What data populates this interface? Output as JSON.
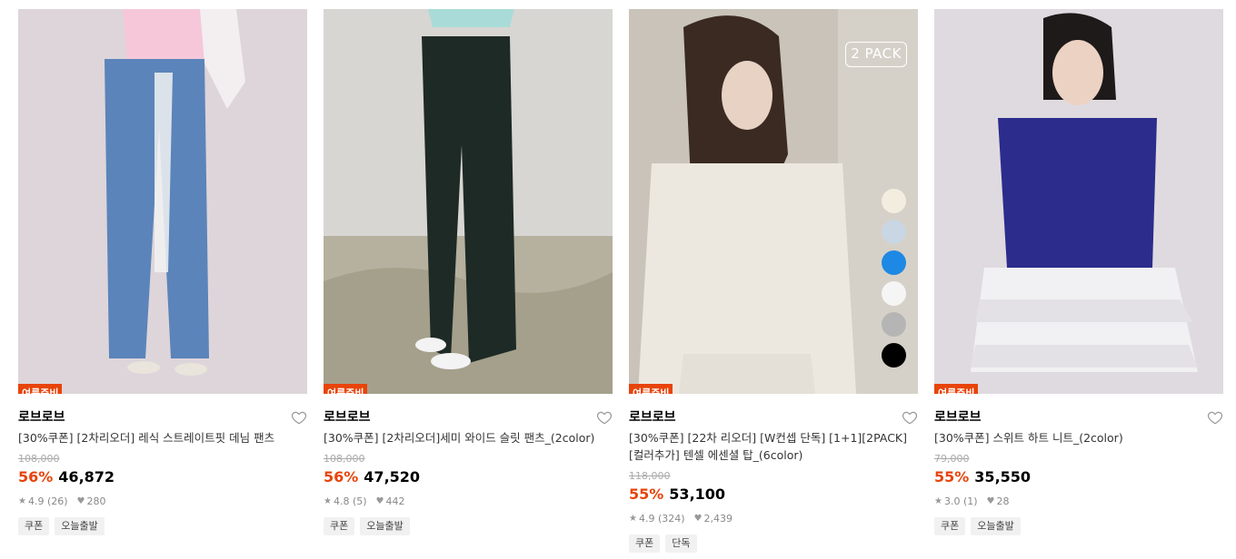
{
  "products": [
    {
      "promo": "여름준비",
      "brand": "로브로브",
      "title": "[30%쿠폰] [2차리오더] 레식 스트레이트핏 데님 팬츠",
      "original_price": "108,000",
      "discount": "56%",
      "price": "46,872",
      "rating": "4.9 (26)",
      "likes": "280",
      "tags": [
        "쿠폰",
        "오늘출발"
      ]
    },
    {
      "promo": "여름준비",
      "brand": "로브로브",
      "title": "[30%쿠폰] [2차리오더]세미 와이드 슬릿 팬츠_(2color)",
      "original_price": "108,000",
      "discount": "56%",
      "price": "47,520",
      "rating": "4.8 (5)",
      "likes": "442",
      "tags": [
        "쿠폰",
        "오늘출발"
      ]
    },
    {
      "promo": "여름준비",
      "brand": "로브로브",
      "title": "[30%쿠폰] [22차 리오더] [W컨셉 단독] [1+1][2PACK][컬러추가] 텐셀 에센셜 탑_(6color)",
      "pack_label": "2 PACK",
      "swatch_colors": [
        "#f3ede0",
        "#c9d6e3",
        "#1e88e5",
        "#f5f5f5",
        "#b5b5b5",
        "#000000"
      ],
      "original_price": "118,000",
      "discount": "55%",
      "price": "53,100",
      "rating": "4.9 (324)",
      "likes": "2,439",
      "tags": [
        "쿠폰",
        "단독"
      ]
    },
    {
      "promo": "여름준비",
      "brand": "로브로브",
      "title": "[30%쿠폰] 스위트 하트 니트_(2color)",
      "original_price": "79,000",
      "discount": "55%",
      "price": "35,550",
      "rating": "3.0 (1)",
      "likes": "28",
      "tags": [
        "쿠폰",
        "오늘출발"
      ]
    }
  ],
  "icons": {
    "wishlist": "heart-outline-icon",
    "rating": "star-icon",
    "likes": "heart-filled-icon"
  },
  "colors": {
    "accent": "#e8440a"
  }
}
